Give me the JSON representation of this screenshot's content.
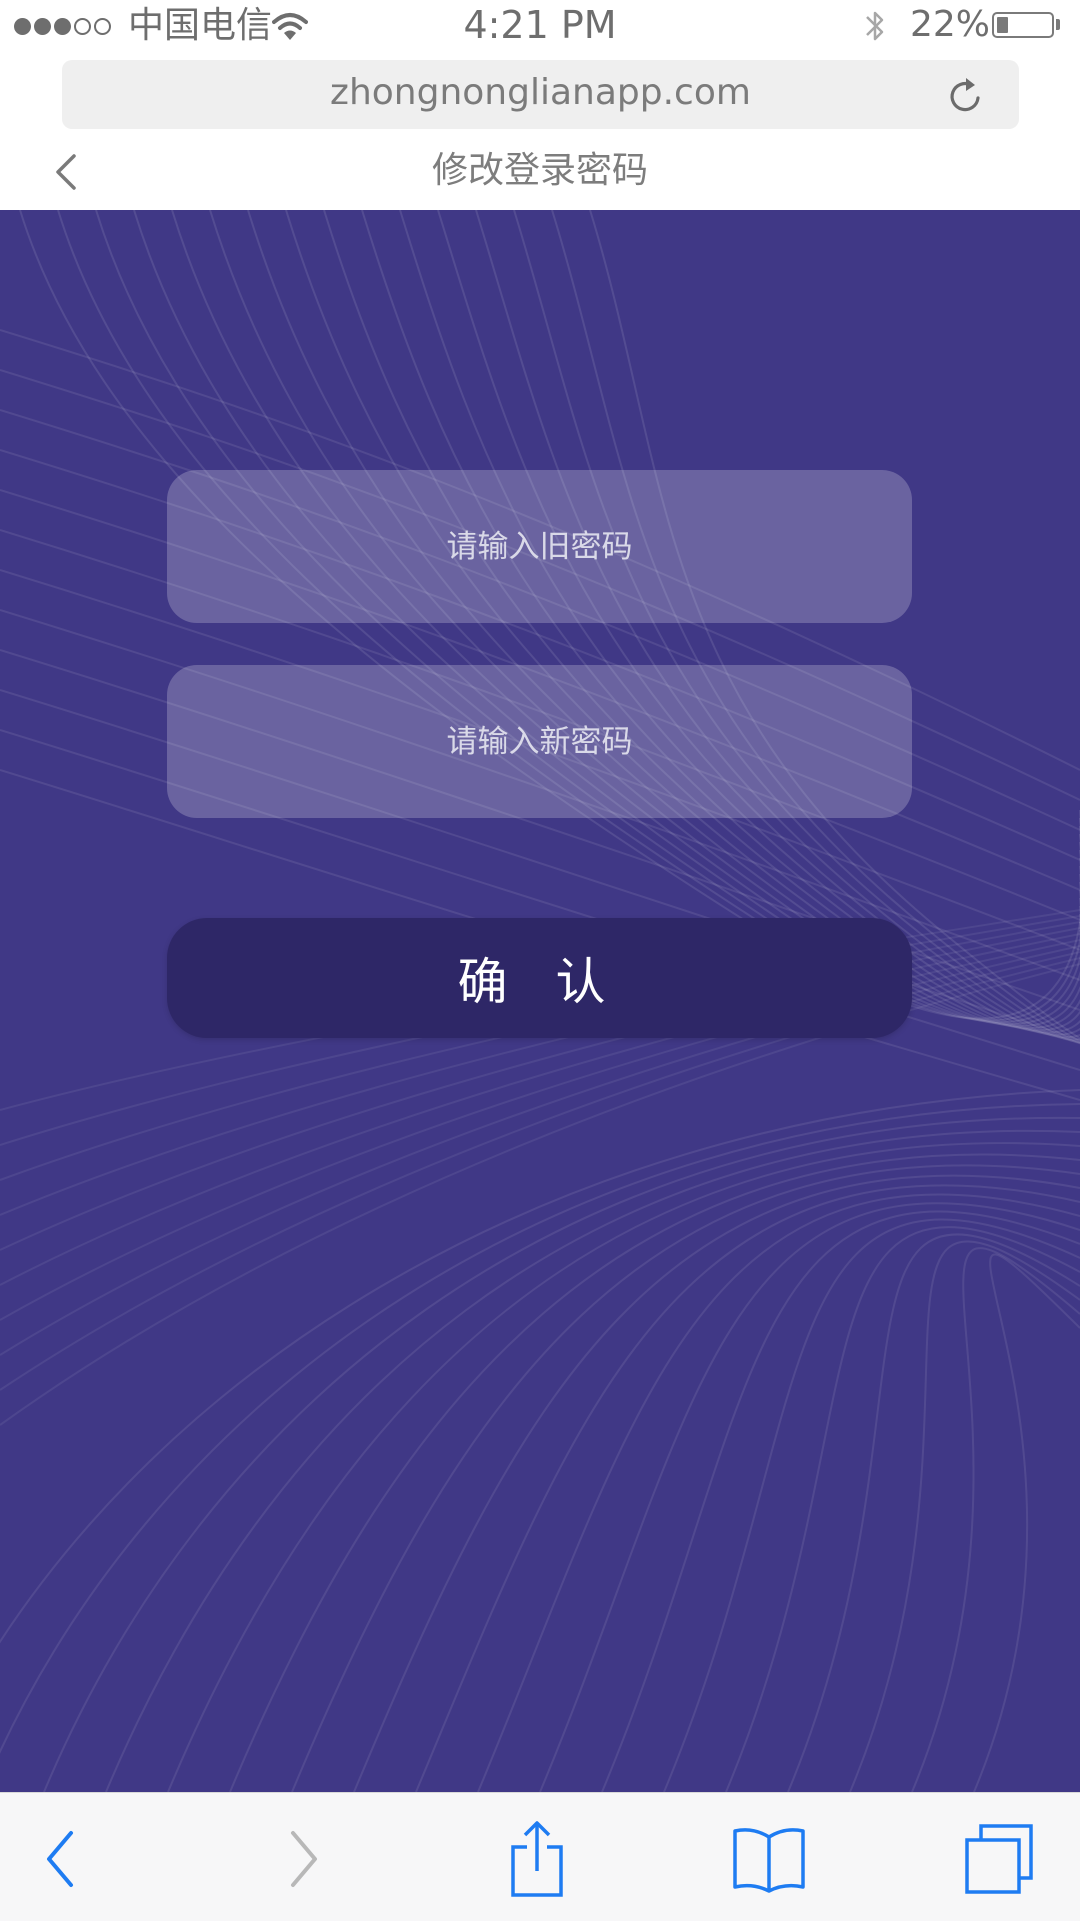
{
  "status_bar": {
    "signal": {
      "filled": 3,
      "total": 5
    },
    "carrier": "中国电信",
    "time": "4:21 PM",
    "battery_percent": "22%",
    "battery_level": 0.22,
    "icons": [
      "signal-dots-icon",
      "wifi-icon",
      "bluetooth-icon",
      "battery-icon"
    ]
  },
  "browser": {
    "url": "zhongnonglianapp.com",
    "reload_icon": "reload-icon"
  },
  "header": {
    "back_icon": "chevron-left-icon",
    "title": "修改登录密码"
  },
  "form": {
    "old_password": {
      "value": "",
      "placeholder": "请输入旧密码"
    },
    "new_password": {
      "value": "",
      "placeholder": "请输入新密码"
    },
    "confirm_label": "确 认"
  },
  "toolbar": {
    "items": [
      "back-arrow-icon",
      "forward-arrow-icon",
      "share-icon",
      "bookmarks-icon",
      "tabs-icon"
    ],
    "forward_enabled": false
  },
  "colors": {
    "background": "#403886",
    "input_fill": "rgba(255,255,255,0.22)",
    "confirm_button": "#2e2767",
    "toolbar_icon": "#1e7cf2",
    "toolbar_icon_disabled": "#b8b8b8"
  }
}
